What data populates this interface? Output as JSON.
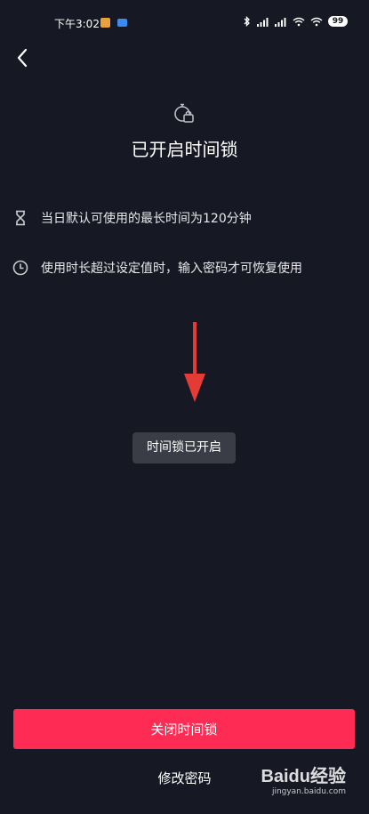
{
  "status_bar": {
    "time": "下午3:02",
    "signal_glyphs": "ᛒ0 ᵢₗ ᵢₗ",
    "wifi_glyphs": "ᯤ ᯤ",
    "battery": "99"
  },
  "header": {
    "title": "已开启时间锁"
  },
  "info": [
    {
      "icon": "hourglass-icon",
      "text": "当日默认可使用的最长时间为120分钟"
    },
    {
      "icon": "clock-icon",
      "text": "使用时长超过设定值时，输入密码才可恢复使用"
    }
  ],
  "toast": "时间锁已开启",
  "actions": {
    "primary_label": "关闭时间锁",
    "secondary_label": "修改密码"
  },
  "watermark": {
    "logo": "Baidu经验",
    "url": "jingyan.baidu.com"
  },
  "colors": {
    "background": "#161823",
    "accent": "#fe2c55",
    "toast_bg": "#3a3c46",
    "arrow": "#e53b36"
  }
}
